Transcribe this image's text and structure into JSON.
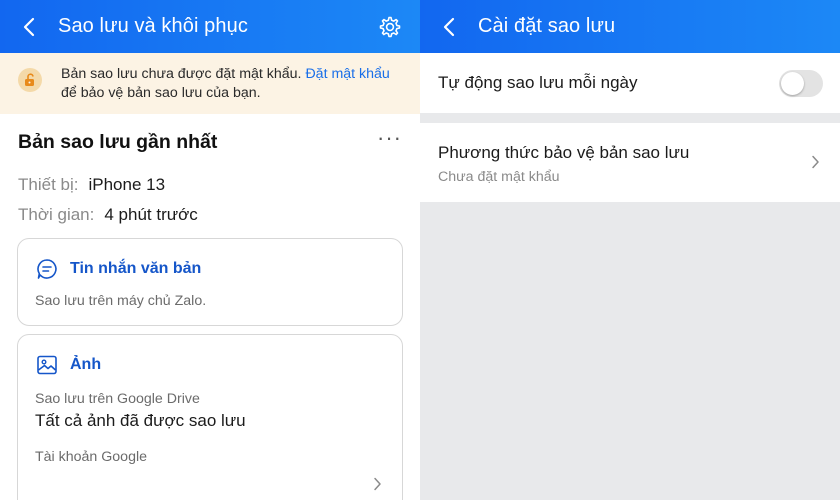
{
  "left": {
    "header": {
      "title": "Sao lưu và khôi phục",
      "back_icon": "chevron-left-icon",
      "settings_icon": "gear-icon"
    },
    "warning": {
      "icon": "unlocked-icon",
      "text_before": "Bản sao lưu chưa được đặt mật khẩu. ",
      "link": "Đặt mật khẩu",
      "text_after": " để bảo vệ bản sao lưu của bạn."
    },
    "latest": {
      "title": "Bản sao lưu gần nhất",
      "more": "···",
      "device_label": "Thiết bị:",
      "device_value": "iPhone 13",
      "time_label": "Thời gian:",
      "time_value": "4 phút trước"
    },
    "messages_card": {
      "icon": "chat-bubble-icon",
      "title": "Tin nhắn văn bản",
      "subtitle": "Sao lưu trên máy chủ Zalo."
    },
    "photos_card": {
      "icon": "image-icon",
      "title": "Ảnh",
      "subtitle": "Sao lưu trên Google Drive",
      "status": "Tất cả ảnh đã được sao lưu",
      "account_label": "Tài khoản Google"
    }
  },
  "right": {
    "header": {
      "title": "Cài đặt sao lưu",
      "back_icon": "chevron-left-icon"
    },
    "auto_backup": {
      "label": "Tự động sao lưu mỗi ngày",
      "enabled": false
    },
    "protection": {
      "title": "Phương thức bảo vệ bản sao lưu",
      "subtitle": "Chưa đặt mật khẩu"
    }
  },
  "colors": {
    "header_start": "#1267f0",
    "header_end": "#1c88f6",
    "link": "#1a6fe8",
    "warning_bg": "#fcf3e4",
    "card_title": "#1556c9"
  }
}
